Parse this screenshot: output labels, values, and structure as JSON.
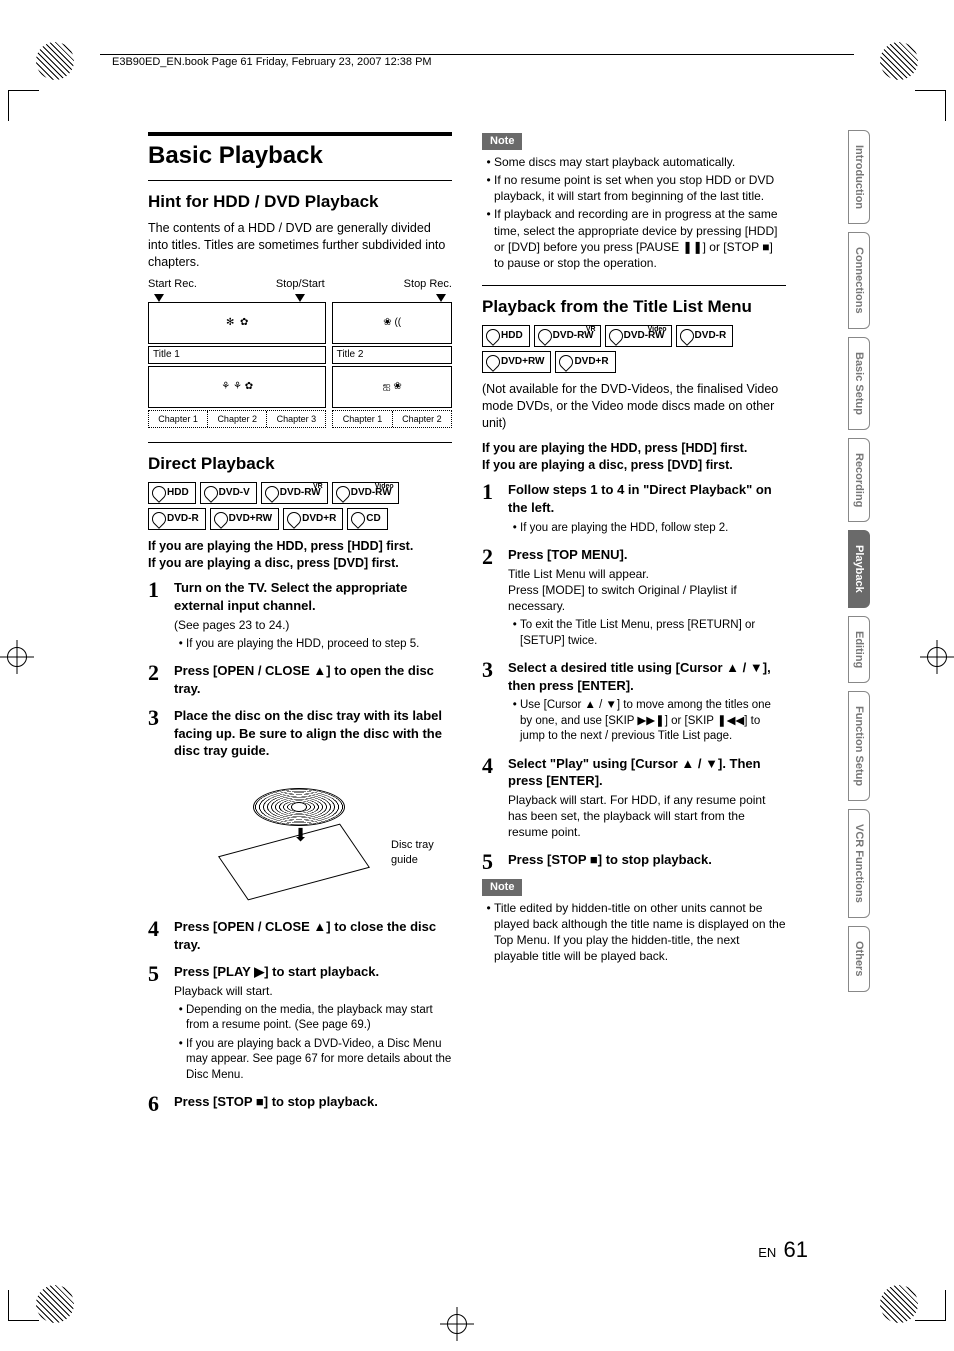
{
  "header": {
    "book_info": "E3B90ED_EN.book  Page 61  Friday, February 23, 2007  12:38 PM"
  },
  "footer": {
    "lang": "EN",
    "page": "61"
  },
  "tabs": [
    "Introduction",
    "Connections",
    "Basic Setup",
    "Recording",
    "Playback",
    "Editing",
    "Function Setup",
    "VCR Functions",
    "Others"
  ],
  "active_tab_index": 4,
  "left": {
    "h1": "Basic Playback",
    "h2a": "Hint for HDD / DVD Playback",
    "intro": "The contents of a HDD / DVD are generally divided into titles. Titles are sometimes further subdivided into chapters.",
    "diag_labels": [
      "Start Rec.",
      "Stop/Start",
      "Stop Rec."
    ],
    "title1": "Title 1",
    "title2": "Title 2",
    "chapters1": [
      "Chapter 1",
      "Chapter 2",
      "Chapter 3"
    ],
    "chapters2": [
      "Chapter 1",
      "Chapter 2"
    ],
    "h2b": "Direct Playback",
    "badges1": [
      "HDD",
      "DVD-V",
      "DVD-RW",
      "DVD-RW",
      "DVD-R",
      "DVD+RW",
      "DVD+R",
      "CD"
    ],
    "badge1_sups": [
      "",
      "",
      "VR",
      "Video",
      "",
      "",
      "",
      ""
    ],
    "bold_hint": "If you are playing the HDD, press [HDD] first.\nIf you are playing a disc, press [DVD] first.",
    "steps": [
      {
        "title": "Turn on the TV. Select the appropriate external input channel.",
        "sub": "(See pages 23 to 24.)",
        "bullets": [
          "If you are playing the HDD, proceed to step 5."
        ]
      },
      {
        "title": "Press [OPEN / CLOSE ▲] to open the disc tray."
      },
      {
        "title": "Place the disc on the disc tray with its label facing up. Be sure to align the disc with the disc tray guide.",
        "fig_label": "Disc tray guide"
      },
      {
        "title": "Press [OPEN / CLOSE ▲] to close the disc tray."
      },
      {
        "title": "Press [PLAY ▶] to start playback.",
        "sub": "Playback will start.",
        "bullets": [
          "Depending on the media, the playback may start from a resume point. (See page 69.)",
          "If you are playing back a DVD-Video, a Disc Menu may appear. See page 67 for more details about the Disc Menu."
        ]
      },
      {
        "title": "Press [STOP ■] to stop playback."
      }
    ]
  },
  "right": {
    "note1_label": "Note",
    "note1": [
      "Some discs may start playback automatically.",
      "If no resume point is set when you stop HDD or DVD playback, it will start from beginning of the last title.",
      "If playback and recording are in progress at the same time, select the appropriate device by pressing [HDD] or [DVD] before you press [PAUSE ❚❚] or [STOP ■] to pause or stop the operation."
    ],
    "h2": "Playback from the Title List Menu",
    "badges": [
      "HDD",
      "DVD-RW",
      "DVD-RW",
      "DVD-R",
      "DVD+RW",
      "DVD+R"
    ],
    "badge_sups": [
      "",
      "VR",
      "Video",
      "",
      "",
      ""
    ],
    "paren": "(Not available for the DVD-Videos, the finalised Video mode DVDs, or the Video mode discs made on other unit)",
    "bold_hint": "If you are playing the HDD, press [HDD] first.\nIf you are playing a disc, press [DVD] first.",
    "steps": [
      {
        "title": "Follow steps 1 to 4 in \"Direct Playback\" on the left.",
        "bullets": [
          "If you are playing the HDD, follow step 2."
        ]
      },
      {
        "title": "Press [TOP MENU].",
        "sub": "Title List Menu will appear.\nPress [MODE] to switch Original / Playlist if necessary.",
        "bullets": [
          "To exit the Title List Menu, press [RETURN] or [SETUP] twice."
        ]
      },
      {
        "title": "Select a desired title using [Cursor ▲ / ▼], then press [ENTER].",
        "bullets": [
          "Use [Cursor ▲ / ▼] to move among the titles one by one, and use [SKIP ▶▶❚] or [SKIP ❚◀◀] to jump to the next / previous Title List page."
        ]
      },
      {
        "title": "Select \"Play\" using [Cursor ▲ / ▼]. Then press [ENTER].",
        "sub": "Playback will start. For HDD, if any resume point has been set, the playback will start from the resume point."
      },
      {
        "title": "Press [STOP ■] to stop playback."
      }
    ],
    "note2_label": "Note",
    "note2": [
      "Title edited by hidden-title on other units cannot be played back although the title name is displayed on the Top Menu. If you play the hidden-title, the next playable title will be played back."
    ]
  }
}
